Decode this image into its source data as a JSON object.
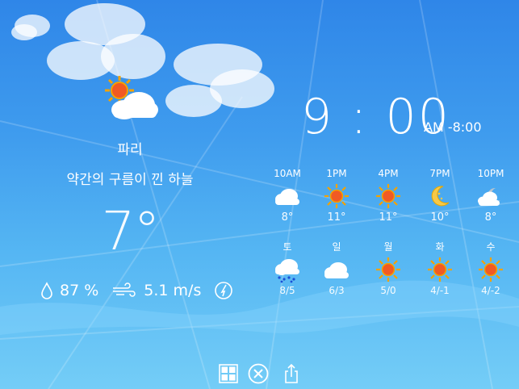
{
  "location": {
    "city": "파리",
    "condition": "약간의 구름이 낀 하늘",
    "temperature": "7°",
    "icon": "partly-sunny-icon"
  },
  "stats": {
    "humidity": "87 %",
    "wind": "5.1 m/s"
  },
  "clock": {
    "time": "9 : 00",
    "ampm_offset": "AM -8:00"
  },
  "hourly": [
    {
      "label": "10AM",
      "icon": "cloud-icon",
      "temp": "8°"
    },
    {
      "label": "1PM",
      "icon": "sun-icon",
      "temp": "11°"
    },
    {
      "label": "4PM",
      "icon": "sun-icon",
      "temp": "11°"
    },
    {
      "label": "7PM",
      "icon": "moon-icon",
      "temp": "10°"
    },
    {
      "label": "10PM",
      "icon": "cloud-night-icon",
      "temp": "8°"
    }
  ],
  "daily": [
    {
      "label": "토",
      "icon": "rain-cloud-icon",
      "range": "8/5"
    },
    {
      "label": "일",
      "icon": "cloud-icon",
      "range": "6/3"
    },
    {
      "label": "월",
      "icon": "sun-icon",
      "range": "5/0"
    },
    {
      "label": "화",
      "icon": "sun-icon",
      "range": "4/-1"
    },
    {
      "label": "수",
      "icon": "sun-icon",
      "range": "4/-2"
    }
  ],
  "toolbar": {
    "grid": "grid-icon",
    "close": "close-icon",
    "share": "share-icon"
  }
}
